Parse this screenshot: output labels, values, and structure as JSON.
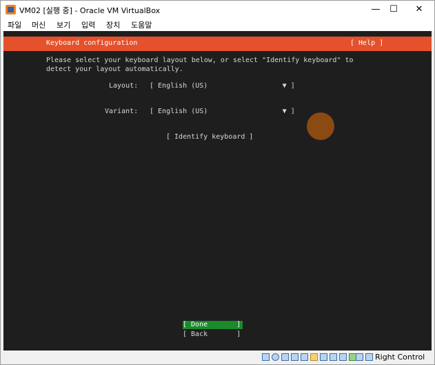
{
  "window": {
    "title": "VM02 [실행 중] - Oracle VM VirtualBox",
    "minimize": "—",
    "maximize": "☐",
    "close": "✕"
  },
  "menu": {
    "items": [
      "파일",
      "머신",
      "보기",
      "입력",
      "장치",
      "도움말"
    ]
  },
  "installer": {
    "header_title": "Keyboard configuration",
    "help_label": "[ Help ]",
    "description_line1": "Please select your keyboard layout below, or select \"Identify keyboard\" to",
    "description_line2": "detect your layout automatically.",
    "layout_label": "Layout:",
    "layout_value": "[ English (US)                  ▼ ]",
    "variant_label": "Variant:",
    "variant_value": "[ English (US)                  ▼ ]",
    "identify_button": "[ Identify keyboard ]",
    "done_button": "[ Done       ]",
    "back_button": "[ Back       ]"
  },
  "statusbar": {
    "host_key": "Right Control",
    "icons": [
      "hard-disk-icon",
      "optical-drive-icon",
      "audio-icon",
      "network-icon",
      "usb-icon",
      "shared-folder-icon",
      "display-icon",
      "video-capture-icon",
      "recording-icon",
      "cpu-icon",
      "mouse-integration-icon",
      "keyboard-icon"
    ]
  },
  "colors": {
    "header_bg": "#e4512c",
    "console_bg": "#1e1e1e",
    "done_bg": "#1a8a2a"
  }
}
